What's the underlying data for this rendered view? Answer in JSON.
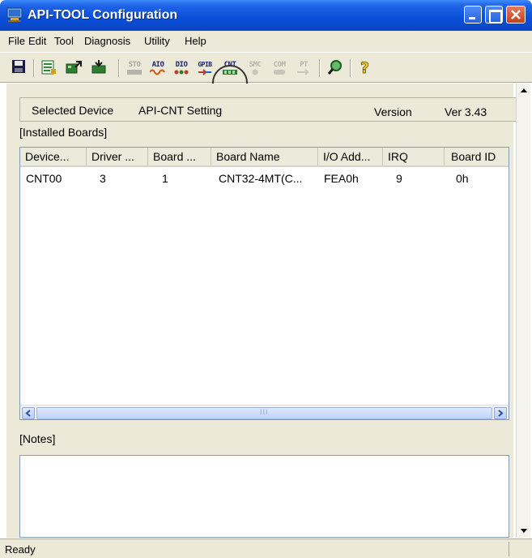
{
  "window": {
    "title": "API-TOOL Configuration"
  },
  "menu": [
    "File",
    "Edit",
    "Tool",
    "Diagnosis",
    "Utility",
    "Help"
  ],
  "toolbar": {
    "text_buttons": [
      "STO",
      "AIO",
      "DIO",
      "GPIB",
      "CNT",
      "SMC",
      "COM",
      "PT"
    ]
  },
  "device": {
    "selected_label": "Selected Device",
    "selected_value": "API-CNT Setting",
    "version_label": "Version",
    "version_value": "Ver 3.43"
  },
  "installed_label": "[Installed Boards]",
  "table": {
    "headers": [
      "Device...",
      "Driver ...",
      "Board ...",
      "Board Name",
      "I/O Add...",
      "IRQ",
      "Board ID"
    ],
    "rows": [
      [
        "CNT00",
        "3",
        "1",
        "CNT32-4MT(C...",
        "FEA0h",
        "9",
        "0h"
      ]
    ]
  },
  "hscroll_grip": "III",
  "notes_label": "[Notes]",
  "status": {
    "text": "Ready"
  }
}
